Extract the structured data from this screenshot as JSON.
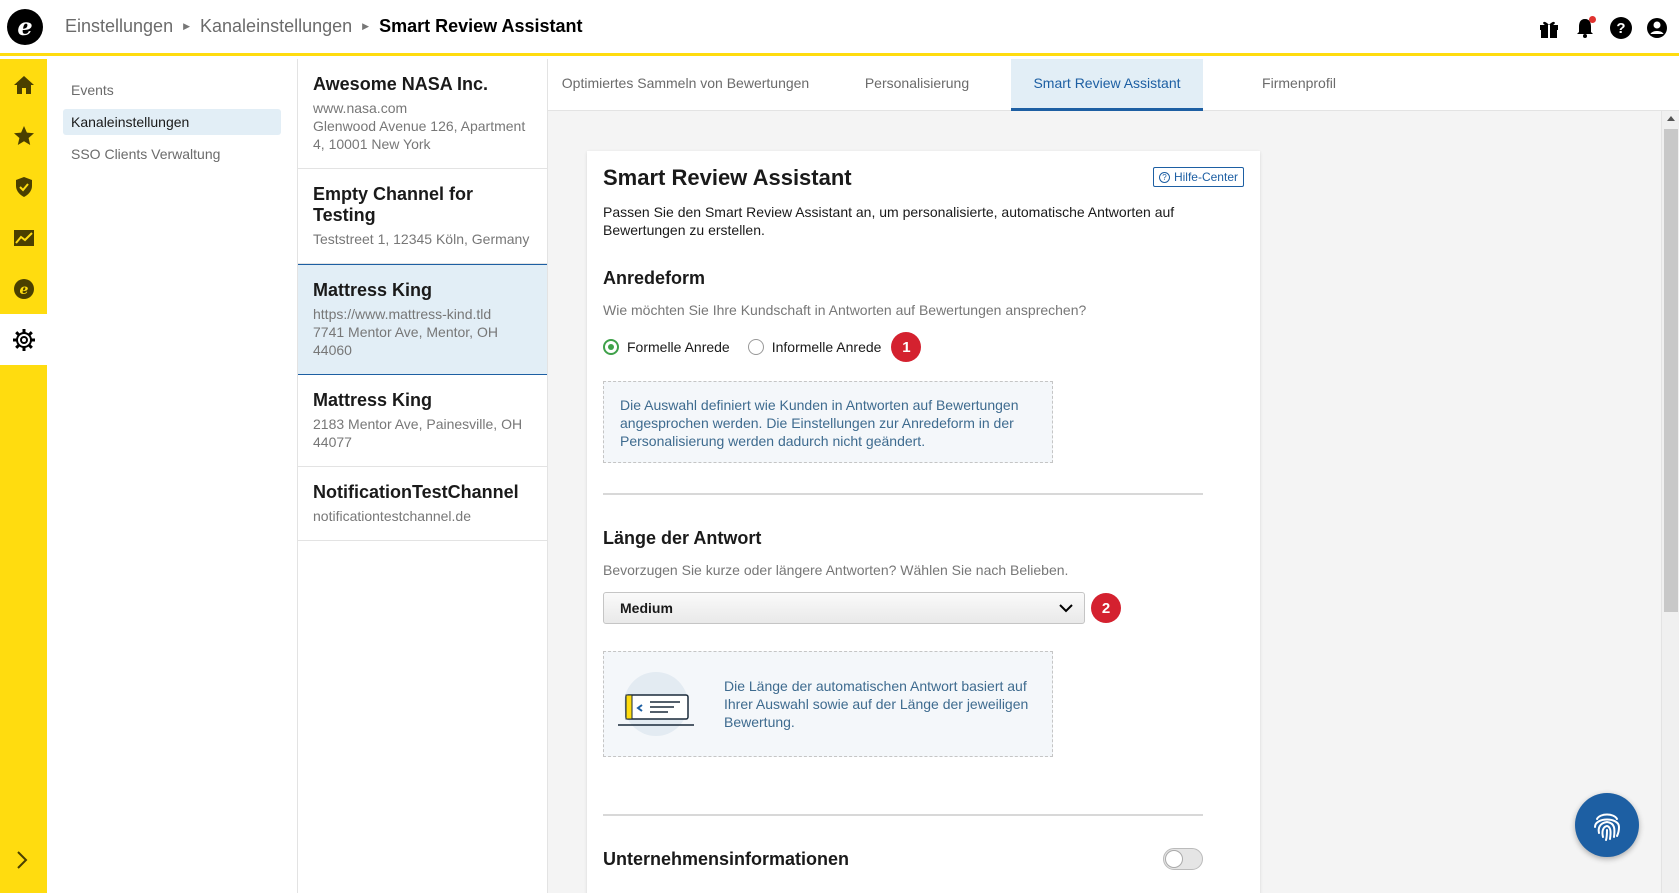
{
  "breadcrumb": {
    "items": [
      "Einstellungen",
      "Kanaleinstellungen"
    ],
    "current": "Smart Review Assistant"
  },
  "topbar_icons": [
    "gift-icon",
    "bell-icon",
    "help-icon",
    "user-icon"
  ],
  "rail": {
    "items": [
      "home-icon",
      "star-icon",
      "shield-icon",
      "chart-icon",
      "trusted-e-icon",
      "gear-icon"
    ],
    "active": "gear-icon"
  },
  "subnav": {
    "items": [
      {
        "label": "Events"
      },
      {
        "label": "Kanaleinstellungen"
      },
      {
        "label": "SSO Clients Verwaltung"
      }
    ]
  },
  "channels": [
    {
      "name": "Awesome NASA Inc.",
      "lines": [
        "www.nasa.com",
        "Glenwood Avenue 126, Apartment 4, 10001 New York"
      ]
    },
    {
      "name": "Empty Channel for Testing",
      "lines": [
        "Teststreet 1, 12345 Köln, Germany"
      ]
    },
    {
      "name": "Mattress King",
      "lines": [
        "https://www.mattress-kind.tld",
        "7741 Mentor Ave, Mentor, OH 44060"
      ]
    },
    {
      "name": "Mattress King",
      "lines": [
        "2183 Mentor Ave, Painesville, OH 44077"
      ]
    },
    {
      "name": "NotificationTestChannel",
      "lines": [
        "notificationtestchannel.de"
      ]
    }
  ],
  "tabs": [
    {
      "label": "Optimiertes Sammeln von Bewertungen"
    },
    {
      "label": "Personalisierung"
    },
    {
      "label": "Smart Review Assistant"
    },
    {
      "label": "Firmenprofil"
    }
  ],
  "card": {
    "title": "Smart Review Assistant",
    "help_label": "Hilfe-Center",
    "description": "Passen Sie den Smart Review Assistant an, um personalisierte, automatische Antworten auf Bewertungen zu erstellen.",
    "anrede": {
      "title": "Anredeform",
      "subtitle": "Wie möchten Sie Ihre Kundschaft in Antworten auf Bewertungen ansprechen?",
      "option_formal": "Formelle Anrede",
      "option_informal": "Informelle Anrede",
      "selected": "Formelle Anrede",
      "badge": "1",
      "info": "Die Auswahl definiert wie Kunden in Antworten auf Bewertungen angesprochen werden. Die Einstellungen zur Anredeform in der Personalisierung werden dadurch nicht geändert."
    },
    "laenge": {
      "title": "Länge der Antwort",
      "subtitle": "Bevorzugen Sie kurze oder längere Antworten? Wählen Sie nach Belieben.",
      "selected": "Medium",
      "badge": "2",
      "info": "Die Länge der automatischen Antwort basiert auf Ihrer Auswahl sowie auf der Länge der jeweiligen Bewertung."
    },
    "unternehmen": {
      "title": "Unternehmensinformationen",
      "enabled": false
    }
  },
  "colors": {
    "brand_yellow": "#ffdc0f",
    "accent_blue": "#1d5fa3",
    "badge_red": "#d4212f",
    "radio_green": "#3fa14a"
  }
}
